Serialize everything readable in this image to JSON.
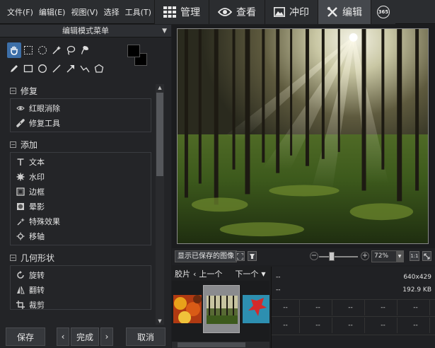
{
  "menus": [
    "文件(F)",
    "编辑(E)",
    "视图(V)",
    "选择",
    "工具(T)",
    "I"
  ],
  "modes": [
    {
      "label": "管理",
      "icon": "grid-icon"
    },
    {
      "label": "查看",
      "icon": "eye-icon"
    },
    {
      "label": "冲印",
      "icon": "photo-icon"
    },
    {
      "label": "编辑",
      "icon": "tools-icon",
      "active": true
    },
    {
      "label": "365",
      "icon": "365-icon"
    }
  ],
  "panel": {
    "title": "编辑模式菜单",
    "sections": [
      {
        "title": "修复",
        "items": [
          {
            "label": "红眼消除",
            "icon": "eye-icon"
          },
          {
            "label": "修复工具",
            "icon": "bandage-icon"
          }
        ]
      },
      {
        "title": "添加",
        "items": [
          {
            "label": "文本",
            "icon": "text-icon"
          },
          {
            "label": "水印",
            "icon": "gear-icon"
          },
          {
            "label": "边框",
            "icon": "border-icon"
          },
          {
            "label": "晕影",
            "icon": "vignette-icon"
          },
          {
            "label": "特殊效果",
            "icon": "sparkle-icon"
          },
          {
            "label": "移轴",
            "icon": "tilt-shift-icon"
          }
        ]
      },
      {
        "title": "几何形状",
        "items": [
          {
            "label": "旋转",
            "icon": "rotate-icon"
          },
          {
            "label": "翻转",
            "icon": "flip-icon"
          },
          {
            "label": "裁剪",
            "icon": "crop-icon"
          }
        ]
      }
    ]
  },
  "buttons": {
    "save": "保存",
    "prev": "‹",
    "done": "完成",
    "next": "›",
    "cancel": "取消"
  },
  "viewer": {
    "show_saved": "显示已保存的图像",
    "zoom": "72%",
    "zoom_out": "−",
    "zoom_in": "+",
    "actual_size": "1:1"
  },
  "strip": {
    "label": "胶片",
    "prev": "上一个",
    "next": "下一个"
  },
  "info": {
    "row1_left": "--",
    "row1_right": "640x429",
    "row2_left": "--",
    "row2_right": "192.9 KB",
    "cells": [
      "--",
      "--",
      "--",
      "--",
      "--",
      "--",
      "--",
      "--",
      "--",
      "--"
    ]
  },
  "colors": {
    "accent": "#3d6fa8",
    "panel_bg": "#232427",
    "active_tab": "#45484d"
  }
}
